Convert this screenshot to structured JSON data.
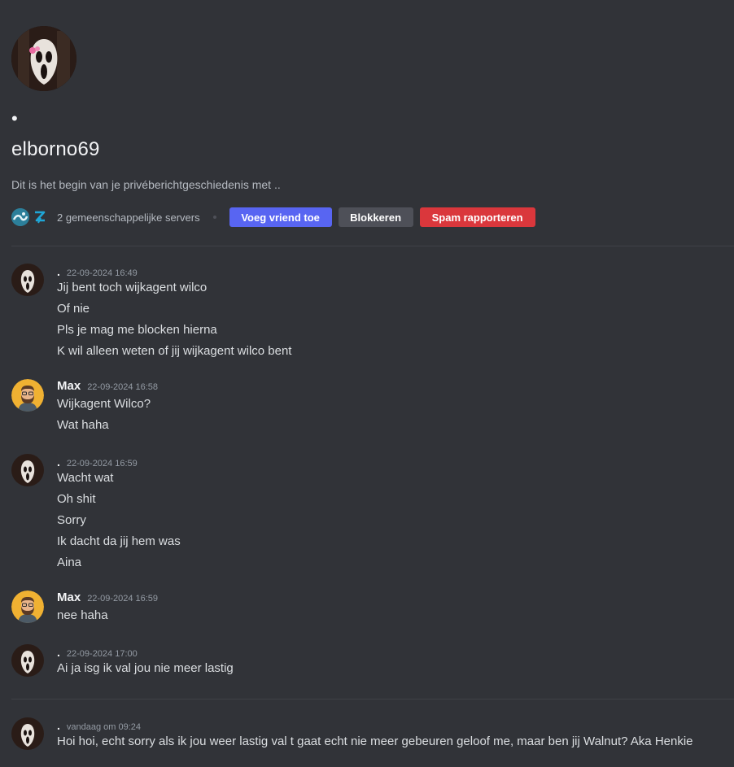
{
  "intro": {
    "dot": "•",
    "username": "elborno69",
    "description": "Dit is het begin van je privéberichtgeschiedenis met ..",
    "mutual_servers": "2 gemeenschappelijke servers",
    "add_friend": "Voeg vriend toe",
    "block": "Blokkeren",
    "report_spam": "Spam rapporteren"
  },
  "messages": [
    {
      "author": ".",
      "timestamp": "22-09-2024 16:49",
      "lines": [
        "Jij bent toch wijkagent wilco",
        "Of nie",
        "Pls je mag me blocken hierna",
        "K wil alleen weten of jij wijkagent wilco bent"
      ]
    },
    {
      "author": "Max",
      "timestamp": "22-09-2024 16:58",
      "lines": [
        "Wijkagent Wilco?",
        "Wat haha"
      ]
    },
    {
      "author": ".",
      "timestamp": "22-09-2024 16:59",
      "lines": [
        "Wacht wat",
        "Oh shit",
        "Sorry",
        "Ik dacht da jij hem was",
        "Aina"
      ]
    },
    {
      "author": "Max",
      "timestamp": "22-09-2024 16:59",
      "lines": [
        "nee haha"
      ]
    },
    {
      "author": ".",
      "timestamp": "22-09-2024 17:00",
      "lines": [
        "Ai ja isg ik val jou nie meer lastig"
      ]
    },
    {
      "author": ".",
      "timestamp": "vandaag om 09:24",
      "lines": [
        "Hoi hoi, echt sorry als ik jou weer lastig val t gaat echt nie meer gebeuren geloof me, maar ben jij Walnut? Aka Henkie"
      ]
    }
  ],
  "colors": {
    "background": "#313338",
    "primary_button": "#5865f2",
    "secondary_button": "#4e5058",
    "danger_button": "#da373c",
    "max_avatar_bg": "#f0b132"
  }
}
